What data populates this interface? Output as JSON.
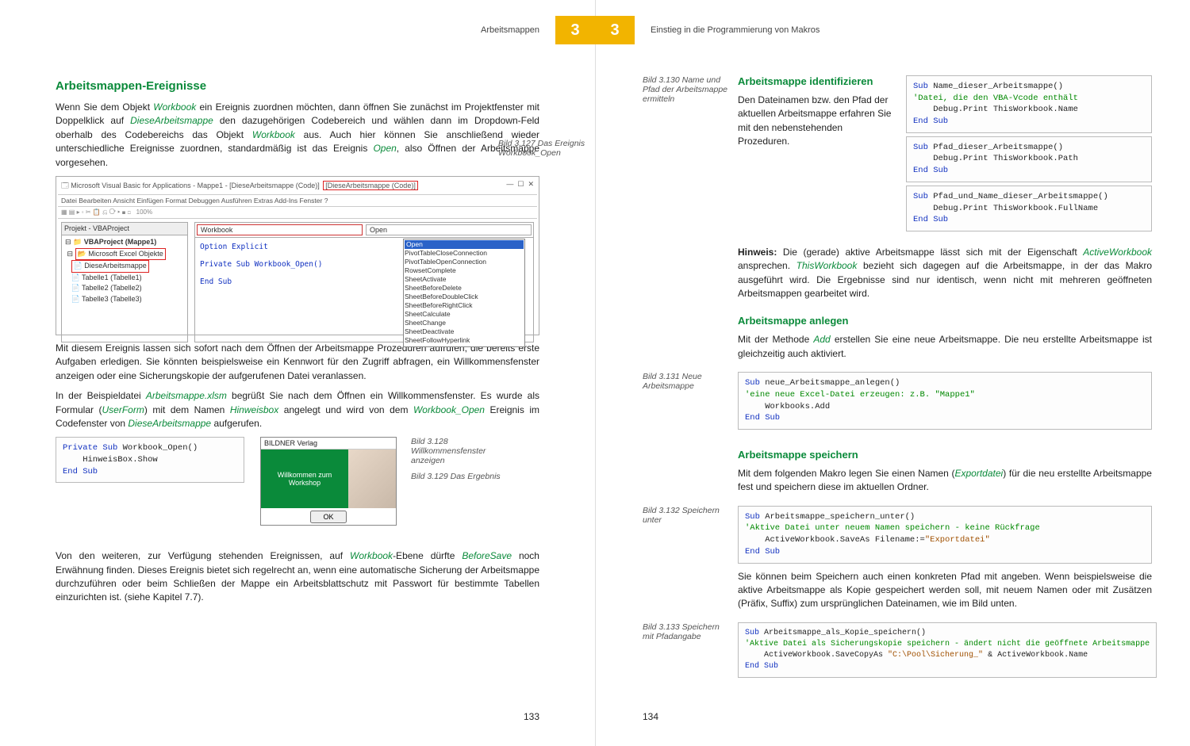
{
  "header": {
    "left_title": "Arbeitsmappen",
    "right_title": "Einstieg in die Programmierung von Makros",
    "chapter": "3"
  },
  "left": {
    "h2": "Arbeitsmappen-Ereignisse",
    "p1a": "Wenn Sie dem Objekt ",
    "p1_workbook": "Workbook",
    "p1b": " ein Ereignis zuordnen möchten, dann öffnen Sie zunächst im Projektfenster mit Doppelklick auf ",
    "p1_diese": "DieseArbeitsmappe",
    "p1c": " den dazugehörigen Codebereich und wählen dann im Dropdown-Feld oberhalb des Codebereichs das Objekt ",
    "p1d": " aus. Auch hier können Sie anschließend wieder unterschiedliche Ereignisse zuordnen, standardmäßig ist das Ereignis ",
    "p1_open": "Open",
    "p1e": ", also Öffnen der Arbeitsmappe vorgesehen.",
    "cap127": "Bild 3.127 Das Ereignis Workbook_Open",
    "ide": {
      "title": "Microsoft Visual Basic for Applications - Mappe1 - [DieseArbeitsmappe (Code)]",
      "menu": "Datei  Bearbeiten  Ansicht  Einfügen  Format  Debuggen  Ausführen  Extras  Add-Ins  Fenster  ?",
      "tree_title": "Projekt - VBAProject",
      "tree_root": "VBAProject (Mappe1)",
      "tree_folder": "Microsoft Excel Objekte",
      "tree_items": [
        "DieseArbeitsmappe",
        "Tabelle1 (Tabelle1)",
        "Tabelle2 (Tabelle2)",
        "Tabelle3 (Tabelle3)"
      ],
      "dd_left": "Workbook",
      "dd_right": "Open",
      "code1": "Option Explicit",
      "code2": "Private Sub Workbook_Open()",
      "code3": "End Sub",
      "events": [
        "Open",
        "PivotTableCloseConnection",
        "PivotTableOpenConnection",
        "RowsetComplete",
        "SheetActivate",
        "SheetBeforeDelete",
        "SheetBeforeDoubleClick",
        "SheetBeforeRightClick",
        "SheetCalculate",
        "SheetChange",
        "SheetDeactivate",
        "SheetFollowHyperlink"
      ]
    },
    "p2": "Mit diesem Ereignis lassen sich sofort nach dem Öffnen der Arbeitsmappe Prozeduren aufrufen, die bereits erste Aufgaben erledigen. Sie könnten beispielsweise ein Kennwort für den Zugriff abfragen, ein Willkommensfenster anzeigen oder eine Sicherungskopie der aufgerufenen Datei veranlassen.",
    "p3a": "In der Beispieldatei ",
    "p3_file": "Arbeitsmappe.xlsm",
    "p3b": " begrüßt Sie nach dem Öffnen ein Willkommensfenster. Es wurde als Formular (",
    "p3_userform": "UserForm",
    "p3c": ") mit dem Namen ",
    "p3_hinweis": "Hinweisbox",
    "p3d": " angelegt und wird von dem ",
    "p3_wbopen": "Workbook_Open",
    "p3e": " Ereignis im Codefenster von ",
    "p3f": " aufgerufen.",
    "code_small": "Private Sub Workbook_Open()\n    HinweisBox.Show\nEnd Sub",
    "cap128": "Bild 3.128 Willkommensfenster anzeigen",
    "cap129": "Bild 3.129 Das Ergebnis",
    "welcome_title": "BILDNER Verlag",
    "welcome_msg": "Willkommen zum Workshop",
    "welcome_ok": "OK",
    "p4a": "Von den weiteren, zur Verfügung stehenden Ereignissen, auf ",
    "p4_wb": "Workbook",
    "p4b": "-Ebene dürfte ",
    "p4_bs": "BeforeSave",
    "p4c": " noch Erwähnung finden. Dieses Ereignis bietet sich regelrecht an, wenn eine automatische Sicherung der Arbeitsmappe durchzuführen oder beim Schließen der Mappe ein Arbeitsblattschutz mit Passwort für bestimmte Tabellen einzurichten ist. (siehe Kapitel 7.7).",
    "pagenum": "133"
  },
  "right": {
    "cap130": "Bild 3.130 Name und Pfad der Arbeitsmappe ermitteln",
    "h3_1": "Arbeitsmappe identifizieren",
    "p1": "Den Dateinamen bzw. den Pfad der aktuellen Arbeitsmappe erfahren Sie mit den nebenstehenden Prozeduren.",
    "code1": "Sub Name_dieser_Arbeitsmappe()\n'Datei, die den VBA-Vcode enthält\n    Debug.Print ThisWorkbook.Name\nEnd Sub",
    "code2": "Sub Pfad_dieser_Arbeitsmappe()\n    Debug.Print ThisWorkbook.Path\nEnd Sub",
    "code3": "Sub Pfad_und_Name_dieser_Arbeitsmappe()\n    Debug.Print ThisWorkbook.FullName\nEnd Sub",
    "hinweis_label": "Hinweis:",
    "hint_a": " Die (gerade) aktive Arbeitsmappe lässt sich mit der Eigenschaft ",
    "hint_aw": "ActiveWorkbook",
    "hint_b": " ansprechen. ",
    "hint_tw": "ThisWorkbook",
    "hint_c": " bezieht sich dagegen auf die Arbeitsmappe, in der das Makro ausgeführt wird. Die Ergebnisse sind nur identisch, wenn nicht mit mehreren geöffneten Arbeitsmappen gearbeitet wird.",
    "h3_2": "Arbeitsmappe anlegen",
    "p2a": "Mit der Methode ",
    "p2_add": "Add",
    "p2b": " erstellen Sie eine neue Arbeitsmappe. Die neu erstellte Arbeitsmappe ist gleichzeitig auch aktiviert.",
    "cap131": "Bild 3.131 Neue Arbeitsmappe",
    "code4": "Sub neue_Arbeitsmappe_anlegen()\n'eine neue Excel-Datei erzeugen: z.B. \"Mappe1\"\n    Workbooks.Add\nEnd Sub",
    "h3_3": "Arbeitsmappe speichern",
    "p3a": "Mit dem folgenden Makro legen Sie einen Namen (",
    "p3_exp": "Exportdatei",
    "p3b": ") für die neu erstellte Arbeitsmappe fest und speichern diese im aktuellen Ordner.",
    "cap132": "Bild 3.132 Speichern unter",
    "code5": "Sub Arbeitsmappe_speichern_unter()\n'Aktive Datei unter neuem Namen speichern - keine Rückfrage\n    ActiveWorkbook.SaveAs Filename:=\"Exportdatei\"\nEnd Sub",
    "p4": "Sie können beim Speichern auch einen konkreten Pfad mit angeben. Wenn beispielsweise die aktive Arbeitsmappe als Kopie gespeichert werden soll, mit neuem Namen oder mit Zusätzen (Präfix, Suffix) zum ursprünglichen Dateinamen, wie im Bild unten.",
    "cap133": "Bild 3.133 Speichern mit Pfadangabe",
    "code6": "Sub Arbeitsmappe_als_Kopie_speichern()\n'Aktive Datei als Sicherungskopie speichern - ändert nicht die geöffnete Arbeitsmappe\n    ActiveWorkbook.SaveCopyAs \"C:\\Pool\\Sicherung_\" & ActiveWorkbook.Name\nEnd Sub",
    "pagenum": "134"
  }
}
